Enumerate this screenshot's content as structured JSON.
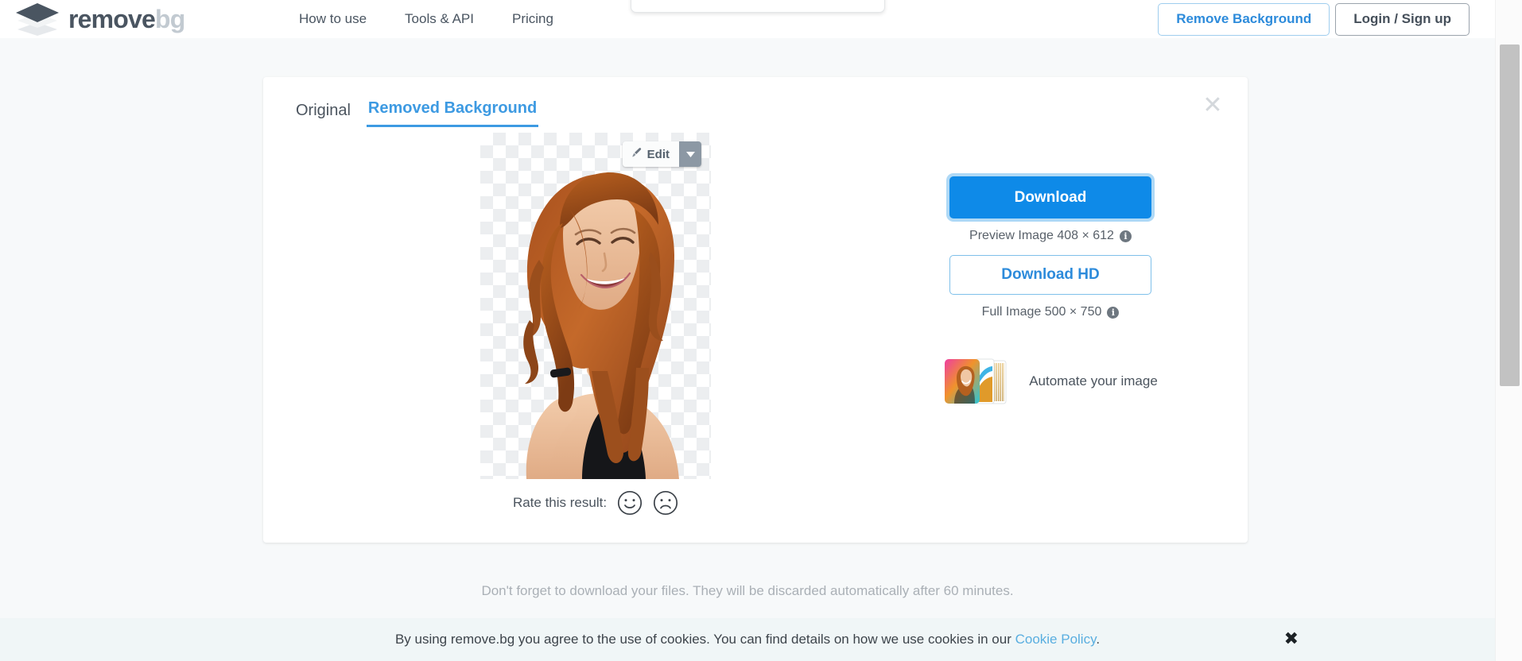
{
  "header": {
    "logo": {
      "icon": "layers-logo-icon",
      "text_primary": "remove",
      "text_secondary": "bg"
    },
    "nav": [
      {
        "label": "How to use"
      },
      {
        "label": "Tools & API"
      },
      {
        "label": "Pricing"
      }
    ],
    "remove_background_button": "Remove Background",
    "login_button": "Login / Sign up"
  },
  "card": {
    "tabs": [
      {
        "label": "Original",
        "active": false
      },
      {
        "label": "Removed Background",
        "active": true
      }
    ],
    "close_icon": "✕",
    "preview": {
      "edit_button_label": "Edit",
      "edit_icon": "brush-icon",
      "caret_icon": "chevron-down-icon",
      "background": "transparent-checkerboard"
    },
    "rating": {
      "label": "Rate this result:",
      "happy_icon": "smiley-happy-icon",
      "sad_icon": "smiley-sad-icon"
    },
    "download": {
      "primary_label": "Download",
      "primary_meta": "Preview Image 408 × 612",
      "hd_label": "Download HD",
      "hd_meta": "Full Image 500 × 750",
      "info_glyph": "i"
    },
    "automate": {
      "label": "Automate your image",
      "thumb_icon": "image-stack-icon"
    }
  },
  "footer": {
    "note": "Don't forget to download your files. They will be discarded automatically after 60 minutes."
  },
  "cookie_bar": {
    "text_before": "By using remove.bg you agree to the use of cookies. You can find details on how we use cookies in our ",
    "link_label": "Cookie Policy",
    "text_after": ".",
    "close_icon": "✖"
  },
  "colors": {
    "accent_blue": "#0e8ae8",
    "link_blue": "#2d8bdb",
    "tab_active": "#3d9ae2",
    "logo_dark": "#4a5561",
    "logo_light": "#c2cad1",
    "page_bg": "#f7f9fa",
    "cookie_bg": "#f0f6f7"
  }
}
